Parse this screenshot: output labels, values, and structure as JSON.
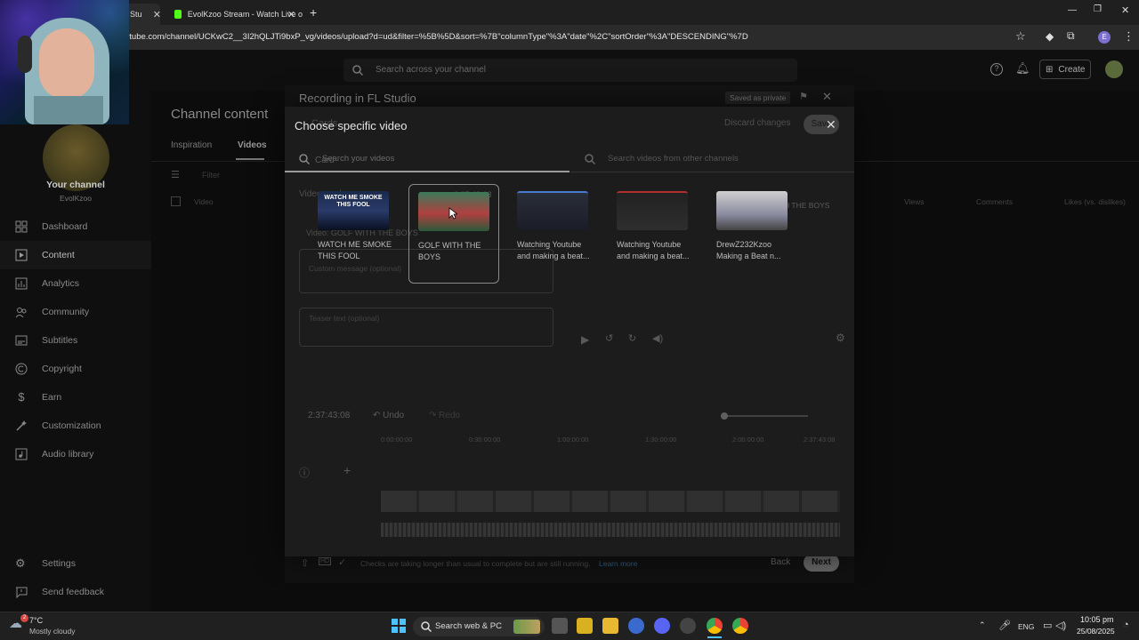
{
  "browser": {
    "tabs": [
      {
        "label": "Stu"
      },
      {
        "label": "EvolKzoo Stream - Watch Live o"
      }
    ],
    "url": "utube.com/channel/UCKwC2__3I2hQLJTi9bxP_vg/videos/upload?d=ud&filter=%5B%5D&sort=%7B\"columnType\"%3A\"date\"%2C\"sortOrder\"%3A\"DESCENDING\"%7D",
    "profile_letter": "E"
  },
  "studio": {
    "search_placeholder": "Search across your channel",
    "create_label": "Create",
    "page_title": "Channel content",
    "tabs": [
      "Inspiration",
      "Videos"
    ],
    "filter_label": "Filter",
    "column_video": "Video",
    "columns_right": [
      "Views",
      "Comments",
      "Likes (vs. dislikes)"
    ],
    "channel_heading": "Your channel",
    "channel_name": "EvolKzoo",
    "sidebar": [
      {
        "label": "Dashboard",
        "icon": "dashboard-icon"
      },
      {
        "label": "Content",
        "icon": "content-icon"
      },
      {
        "label": "Analytics",
        "icon": "analytics-icon"
      },
      {
        "label": "Community",
        "icon": "community-icon"
      },
      {
        "label": "Subtitles",
        "icon": "subtitles-icon"
      },
      {
        "label": "Copyright",
        "icon": "copyright-icon"
      },
      {
        "label": "Earn",
        "icon": "earn-icon"
      },
      {
        "label": "Customization",
        "icon": "customization-icon"
      },
      {
        "label": "Audio library",
        "icon": "audio-library-icon"
      }
    ],
    "settings_label": "Settings",
    "feedback_label": "Send feedback"
  },
  "editor": {
    "title": "Recording in FL Studio",
    "visibility": "Saved as private",
    "section": "Cards",
    "discard_label": "Discard changes",
    "save_label": "Save",
    "card_label": "Card",
    "video_card_heading": "Video card",
    "video_card_text": "Video: GOLF WITH THE BOYS",
    "custom_message_placeholder": "Custom message (optional)",
    "teaser_placeholder": "Teaser text (optional)",
    "preview_card": "GOLF WITH THE BOYS",
    "time_badge": "2:37:43:08",
    "timecode": "2:37:43:08",
    "undo_label": "Undo",
    "redo_label": "Redo",
    "ruler": [
      "0:00:00:00",
      "0:30:00:00",
      "1:00:00:00",
      "1:30:00:00",
      "2:00:00:00",
      "2:37:43:08"
    ],
    "checks_text": "Checks are taking longer than usual to complete but are still running.",
    "learn_more": "Learn more",
    "back_label": "Back",
    "next_label": "Next"
  },
  "chooser": {
    "title": "Choose specific video",
    "search_own_placeholder": "Search your videos",
    "search_other_placeholder": "Search videos from other channels",
    "videos": [
      {
        "title": "WATCH ME SMOKE THIS FOOL",
        "thumb_text": "WATCH ME SMOKE THIS FOOL"
      },
      {
        "title": "GOLF WITH THE BOYS",
        "thumb_text": ""
      },
      {
        "title": "Watching Youtube and making a beat...",
        "thumb_text": ""
      },
      {
        "title": "Watching Youtube and making a beat...",
        "thumb_text": ""
      },
      {
        "title": "DrewZ232Kzoo Making a Beat n...",
        "thumb_text": ""
      }
    ]
  },
  "taskbar": {
    "weather_temp": "7°C",
    "weather_desc": "Mostly cloudy",
    "weather_badge": "2",
    "search_label": "Search web & PC",
    "lang": "ENG",
    "time": "10:05 pm",
    "date": "25/08/2025"
  },
  "colors": {
    "page_bg": "#0f0f0f",
    "modal_bg": "#1c1c1c",
    "selected_border": "#8a8a8a",
    "accent_blue": "#3ea6ff"
  }
}
